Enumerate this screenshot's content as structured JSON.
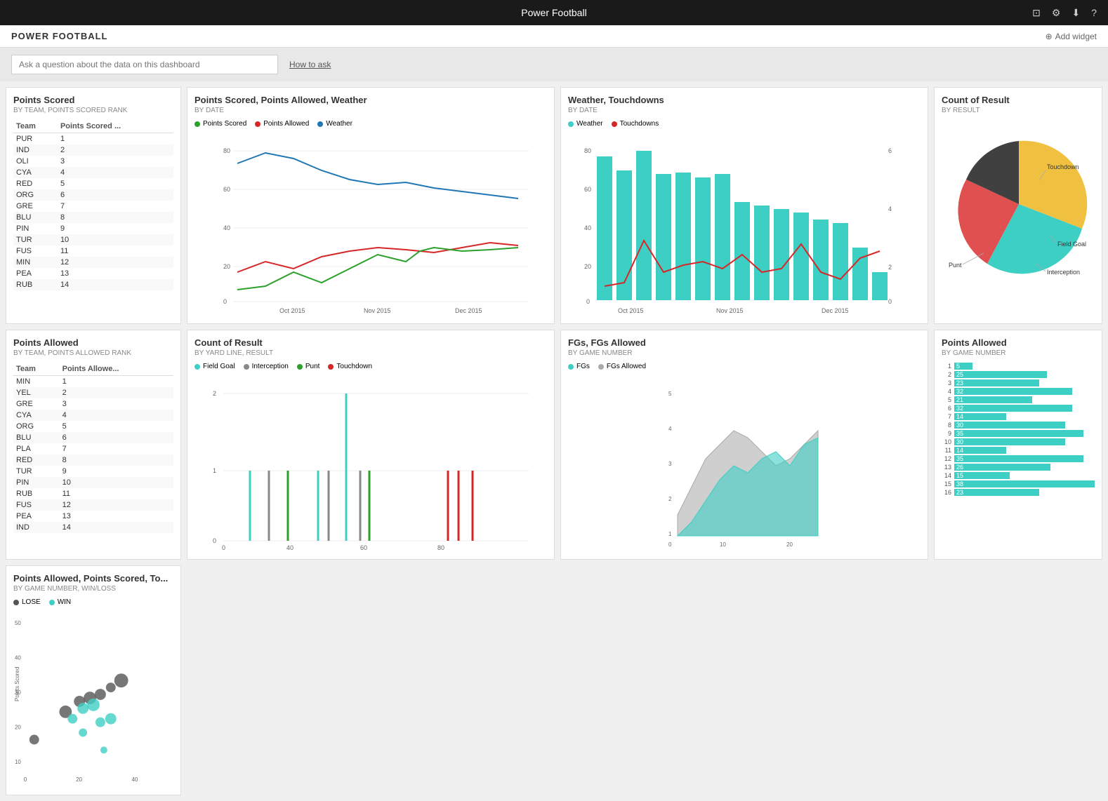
{
  "topBar": {
    "title": "Power Football"
  },
  "header": {
    "title": "POWER FOOTBALL",
    "addWidget": "Add widget"
  },
  "searchBar": {
    "placeholder": "Ask a question about the data on this dashboard",
    "howToAsk": "How to ask"
  },
  "widgets": {
    "pointsScored": {
      "title": "Points Scored",
      "subtitle": "BY TEAM, POINTS SCORED RANK",
      "columns": [
        "Team",
        "Points Scored ..."
      ],
      "rows": [
        [
          "PUR",
          "1"
        ],
        [
          "IND",
          "2"
        ],
        [
          "OLI",
          "3"
        ],
        [
          "CYA",
          "4"
        ],
        [
          "RED",
          "5"
        ],
        [
          "ORG",
          "6"
        ],
        [
          "GRE",
          "7"
        ],
        [
          "BLU",
          "8"
        ],
        [
          "PIN",
          "9"
        ],
        [
          "TUR",
          "10"
        ],
        [
          "FUS",
          "11"
        ],
        [
          "MIN",
          "12"
        ],
        [
          "PEA",
          "13"
        ],
        [
          "RUB",
          "14"
        ]
      ]
    },
    "pointsScoredAllowedWeather": {
      "title": "Points Scored, Points Allowed, Weather",
      "subtitle": "BY DATE",
      "legend": [
        {
          "label": "Points Scored",
          "color": "#2ca02c"
        },
        {
          "label": "Points Allowed",
          "color": "#d62728"
        },
        {
          "label": "Weather",
          "color": "#1f77b4"
        }
      ]
    },
    "weatherTouchdowns": {
      "title": "Weather, Touchdowns",
      "subtitle": "BY DATE",
      "legend": [
        {
          "label": "Weather",
          "color": "#3ecfc4"
        },
        {
          "label": "Touchdowns",
          "color": "#d62728"
        }
      ]
    },
    "countOfResult": {
      "title": "Count of Result",
      "subtitle": "BY RESULT",
      "legend": [
        {
          "label": "Touchdown",
          "color": "#f0c040"
        },
        {
          "label": "Field Goal",
          "color": "#3ecfc4"
        },
        {
          "label": "Punt",
          "color": "#e05050"
        },
        {
          "label": "Interception",
          "color": "#404040"
        }
      ]
    },
    "pointsAllowed": {
      "title": "Points Allowed",
      "subtitle": "BY TEAM, POINTS ALLOWED RANK",
      "columns": [
        "Team",
        "Points Allowe..."
      ],
      "rows": [
        [
          "MIN",
          "1"
        ],
        [
          "YEL",
          "2"
        ],
        [
          "GRE",
          "3"
        ],
        [
          "CYA",
          "4"
        ],
        [
          "ORG",
          "5"
        ],
        [
          "BLU",
          "6"
        ],
        [
          "PLA",
          "7"
        ],
        [
          "RED",
          "8"
        ],
        [
          "TUR",
          "9"
        ],
        [
          "PIN",
          "10"
        ],
        [
          "RUB",
          "11"
        ],
        [
          "FUS",
          "12"
        ],
        [
          "PEA",
          "13"
        ],
        [
          "IND",
          "14"
        ]
      ]
    },
    "countOfResultByYardLine": {
      "title": "Count of Result",
      "subtitle": "BY YARD LINE, RESULT",
      "legend": [
        {
          "label": "Field Goal",
          "color": "#3ecfc4"
        },
        {
          "label": "Interception",
          "color": "#888"
        },
        {
          "label": "Punt",
          "color": "#2ca02c"
        },
        {
          "label": "Touchdown",
          "color": "#d62728"
        }
      ]
    },
    "fgsFgsAllowed": {
      "title": "FGs, FGs Allowed",
      "subtitle": "BY GAME NUMBER",
      "legend": [
        {
          "label": "FGs",
          "color": "#3ecfc4"
        },
        {
          "label": "FGs Allowed",
          "color": "#aaa"
        }
      ]
    },
    "pointsAllowedScored": {
      "title": "Points Allowed, Points Scored, To...",
      "subtitle": "BY GAME NUMBER, WIN/LOSS",
      "legend": [
        {
          "label": "LOSE",
          "color": "#555"
        },
        {
          "label": "WIN",
          "color": "#3ecfc4"
        }
      ]
    },
    "pointsAllowedByGame": {
      "title": "Points Allowed",
      "subtitle": "BY GAME NUMBER",
      "bars": [
        {
          "label": "1",
          "value": 5,
          "max": 38
        },
        {
          "label": "2",
          "value": 25,
          "max": 38
        },
        {
          "label": "3",
          "value": 23,
          "max": 38
        },
        {
          "label": "4",
          "value": 32,
          "max": 38
        },
        {
          "label": "5",
          "value": 21,
          "max": 38
        },
        {
          "label": "6",
          "value": 32,
          "max": 38
        },
        {
          "label": "7",
          "value": 14,
          "max": 38
        },
        {
          "label": "8",
          "value": 30,
          "max": 38
        },
        {
          "label": "9",
          "value": 35,
          "max": 38
        },
        {
          "label": "10",
          "value": 30,
          "max": 38
        },
        {
          "label": "11",
          "value": 14,
          "max": 38
        },
        {
          "label": "12",
          "value": 35,
          "max": 38
        },
        {
          "label": "13",
          "value": 26,
          "max": 38
        },
        {
          "label": "14",
          "value": 15,
          "max": 38
        },
        {
          "label": "15",
          "value": 38,
          "max": 38
        },
        {
          "label": "16",
          "value": 23,
          "max": 38
        }
      ]
    }
  }
}
